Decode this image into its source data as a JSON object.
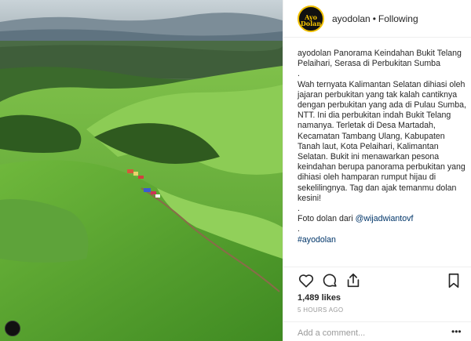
{
  "post": {
    "username": "ayodolan",
    "separator": "•",
    "follow_state": "Following",
    "avatar_text": "Ayo Dolan"
  },
  "caption": {
    "author": "ayodolan",
    "title": "Panorama Keindahan Bukit Telang Pelaihari, Serasa di Perbukitan Sumba",
    "dot": ".",
    "body": "Wah ternyata Kalimantan Selatan dihiasi oleh jajaran perbukitan yang tak kalah cantiknya dengan perbukitan yang ada di Pulau Sumba, NTT. Ini dia perbukitan indah Bukit Telang namanya. Terletak di Desa Martadah, Kecamatan Tambang Ulang, Kabupaten Tanah laut, Kota Pelaihari, Kalimantan Selatan. Bukit ini menawarkan pesona keindahan berupa panorama perbukitan yang dihiasi oleh hamparan rumput hijau di sekelilingnya. Tag dan ajak temanmu dolan kesini!",
    "credit_prefix": "Foto dolan dari",
    "credit_mention": "@wijadwiantovf",
    "hashtag": "#ayodolan"
  },
  "engagement": {
    "likes": "1,489 likes",
    "time": "5 HOURS AGO"
  },
  "comment": {
    "placeholder": "Add a comment...",
    "more": "•••"
  },
  "icons": {
    "like": "heart-icon",
    "comment": "comment-icon",
    "share": "share-icon",
    "save": "bookmark-icon"
  },
  "colors": {
    "link": "#003569",
    "muted": "#999999",
    "text": "#262626",
    "avatar_ring": "#f0c000"
  }
}
